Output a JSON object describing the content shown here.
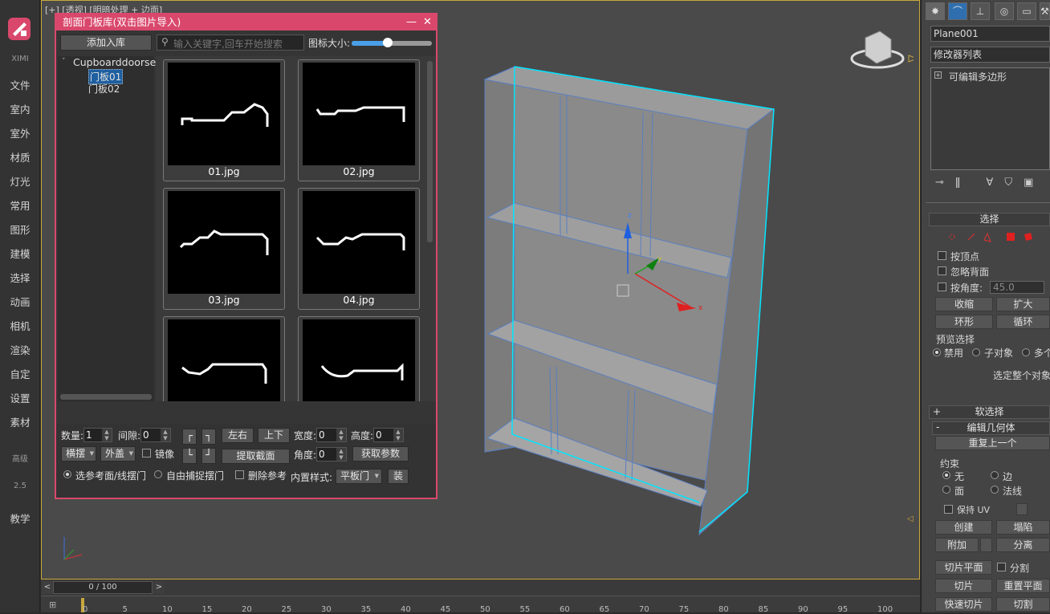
{
  "leftbar": {
    "brand": "XIMI",
    "items": [
      "文件",
      "室内",
      "室外",
      "材质",
      "灯光",
      "常用",
      "图形",
      "建模",
      "选择",
      "动画",
      "相机",
      "渲染",
      "自定",
      "设置",
      "素材"
    ],
    "extra_small": "高级",
    "version": "2.5",
    "bottom": "教学"
  },
  "viewport": {
    "label": "[+] [透视] [明暗处理 + 边面]",
    "gizmo_axes": {
      "x": "x",
      "y": "y",
      "z": "z"
    }
  },
  "timeline": {
    "frame": "0 / 100",
    "prev": "<",
    "next": ">",
    "ticks": [
      "0",
      "5",
      "10",
      "15",
      "20",
      "25",
      "30",
      "35",
      "40",
      "45",
      "50",
      "55",
      "60",
      "65",
      "70",
      "75",
      "80",
      "85",
      "90",
      "95",
      "100"
    ]
  },
  "dialog": {
    "title": "剖面门板库(双击图片导入)",
    "minimize": "—",
    "close": "✕",
    "add_to_library": "添加入库",
    "search_placeholder": "输入关键字,回车开始搜索",
    "icon_size_label": "图标大小:",
    "icon_size_level": 0.45,
    "tree": {
      "root": "Cupboarddoorse",
      "children": [
        "门板01",
        "门板02"
      ],
      "selected": 0
    },
    "thumbnails": [
      "01.jpg",
      "02.jpg",
      "03.jpg",
      "04.jpg",
      "",
      ""
    ],
    "controls": {
      "count_label": "数量:",
      "count_value": "1",
      "gap_label": "间隙:",
      "gap_value": "0",
      "lr_button": "左右",
      "ud_button": "上下",
      "width_label": "宽度:",
      "width_value": "0",
      "height_label": "高度:",
      "height_value": "0",
      "orientation_select": "横摆",
      "cover_select": "外盖",
      "mirror_label": "镜像",
      "extract_button": "提取截面",
      "angle_label": "角度:",
      "angle_value": "0",
      "get_params_button": "获取参数",
      "radio_ref": "选参考面/线摆门",
      "radio_free": "自由捕捉摆门",
      "delete_ref_label": "删除参考",
      "builtin_style_label": "内置样式:",
      "builtin_style_value": "平板门",
      "install_button": "装"
    }
  },
  "cmdpanel": {
    "object_name": "Plane001",
    "modifier_list": "修改器列表",
    "stack_item": "可编辑多边形",
    "selection": {
      "title": "选择",
      "by_vertex": "按顶点",
      "ignore_backface": "忽略背面",
      "by_angle": "按角度:",
      "angle_value": "45.0",
      "shrink": "收缩",
      "grow": "扩大",
      "ring": "环形",
      "loop": "循环",
      "preview_label": "预览选择",
      "preview_off": "禁用",
      "preview_sub": "子对象",
      "preview_multi": "多个",
      "select_whole": "选定整个对象"
    },
    "soft_selection": "软选择",
    "edit_geometry": {
      "title": "编辑几何体",
      "repeat_last": "重复上一个",
      "constraints_label": "约束",
      "c_none": "无",
      "c_edge": "边",
      "c_face": "面",
      "c_normal": "法线",
      "preserve_uv": "保持 UV",
      "create": "创建",
      "collapse": "塌陷",
      "attach": "附加",
      "detach": "分离",
      "slice_plane": "切片平面",
      "split": "分割",
      "slice": "切片",
      "reset_plane": "重置平面",
      "quick_slice": "快速切片",
      "cut": "切割"
    },
    "colors": {
      "accent": "#d9486c",
      "highlight": "#00e5ff",
      "frame": "#c8a83c"
    }
  }
}
